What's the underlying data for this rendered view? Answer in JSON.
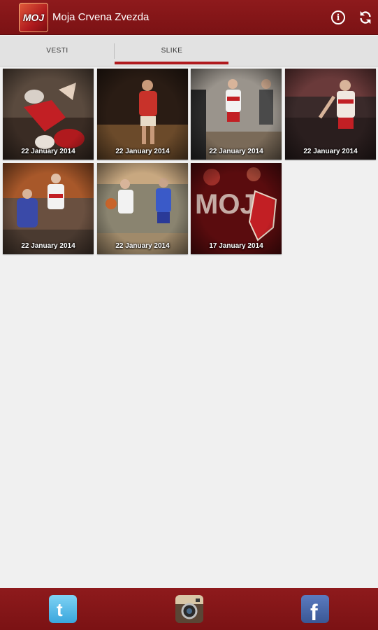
{
  "app": {
    "title": "Moja Crvena Zvezda",
    "icon_label": "MOJ"
  },
  "tabs": [
    {
      "label": "VESTI",
      "selected": false
    },
    {
      "label": "SLIKE",
      "selected": true
    }
  ],
  "gallery": [
    {
      "date": "22 January 2014"
    },
    {
      "date": "22 January 2014"
    },
    {
      "date": "22 January 2014"
    },
    {
      "date": "22 January 2014"
    },
    {
      "date": "22 January 2014"
    },
    {
      "date": "22 January 2014"
    },
    {
      "date": "17 January 2014"
    }
  ],
  "social": [
    "twitter-icon",
    "instagram-icon",
    "facebook-icon"
  ],
  "colors": {
    "brand_red": "#8e1a1c",
    "tab_indicator": "#b01a1e",
    "background": "#f0f0f0"
  }
}
